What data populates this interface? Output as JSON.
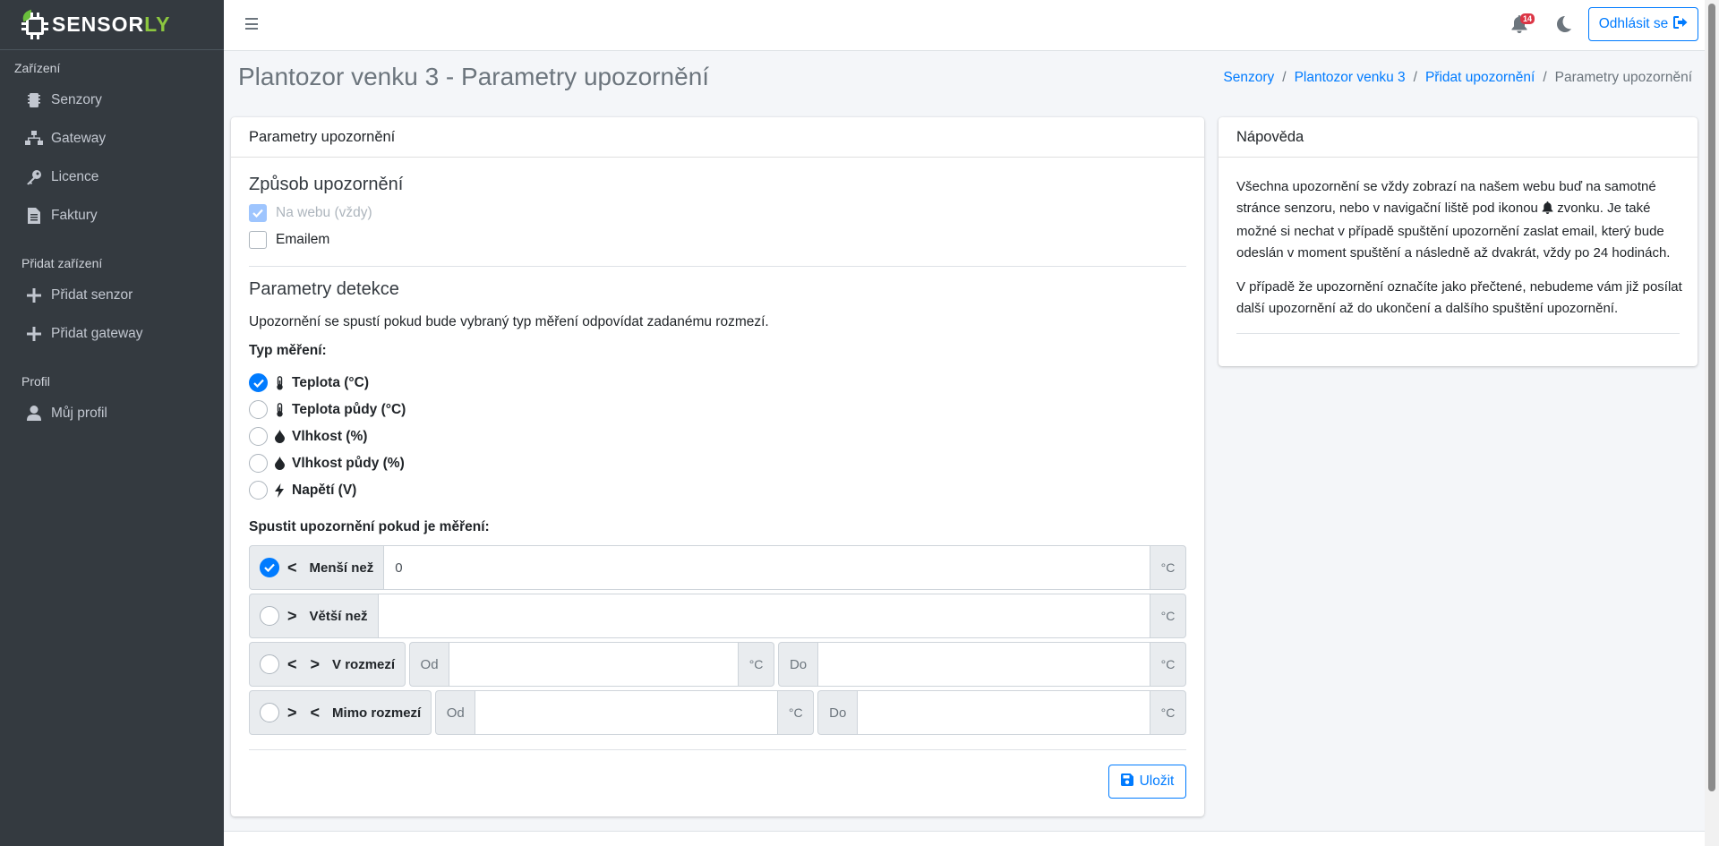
{
  "brand": {
    "name_main": "SENSOR",
    "name_accent": "LY",
    "accent_color": "#8cc63f"
  },
  "sidebar": {
    "section_devices": "Zařízení",
    "items_devices": [
      {
        "label": "Senzory",
        "icon": "microchip-icon"
      },
      {
        "label": "Gateway",
        "icon": "network-icon"
      },
      {
        "label": "Licence",
        "icon": "key-icon"
      },
      {
        "label": "Faktury",
        "icon": "invoice-icon"
      }
    ],
    "section_add": "Přidat zařízení",
    "items_add": [
      {
        "label": "Přidat senzor",
        "icon": "plus-icon"
      },
      {
        "label": "Přidat gateway",
        "icon": "plus-icon"
      }
    ],
    "section_profile": "Profil",
    "items_profile": [
      {
        "label": "Můj profil",
        "icon": "user-icon"
      }
    ]
  },
  "topbar": {
    "notifications_count": "14",
    "logout_label": "Odhlásit se"
  },
  "page": {
    "title": "Plantozor venku 3 - Parametry upozornění",
    "breadcrumb": [
      "Senzory",
      "Plantozor venku 3",
      "Přidat upozornění",
      "Parametry upozornění"
    ]
  },
  "form": {
    "card_title": "Parametry upozornění",
    "method_title": "Způsob upozornění",
    "method_web": "Na webu (vždy)",
    "method_email": "Emailem",
    "detection_title": "Parametry detekce",
    "detection_desc": "Upozornění se spustí pokud bude vybraný typ měření odpovídat zadanému rozmezí.",
    "type_label": "Typ měření:",
    "types": [
      {
        "label": "Teplota (°C)",
        "icon": "thermometer-icon",
        "selected": true
      },
      {
        "label": "Teplota půdy (°C)",
        "icon": "thermometer-icon",
        "selected": false
      },
      {
        "label": "Vlhkost (%)",
        "icon": "droplet-icon",
        "selected": false
      },
      {
        "label": "Vlhkost půdy (%)",
        "icon": "droplet-icon",
        "selected": false
      },
      {
        "label": "Napětí (V)",
        "icon": "bolt-icon",
        "selected": false
      }
    ],
    "trigger_label": "Spustit upozornění pokud je měření:",
    "conditions": {
      "less": {
        "symbol": "<",
        "label": "Menší než",
        "value": "0",
        "unit": "°C",
        "selected": true
      },
      "greater": {
        "symbol": ">",
        "label": "Větší než",
        "value": "",
        "unit": "°C",
        "selected": false
      },
      "range": {
        "symbol": "< >",
        "label": "V rozmezí",
        "from": "Od",
        "to": "Do",
        "unit": "°C",
        "selected": false
      },
      "outside": {
        "symbol": "> <",
        "label": "Mimo rozmezí",
        "from": "Od",
        "to": "Do",
        "unit": "°C",
        "selected": false
      }
    },
    "save_label": "Uložit"
  },
  "help": {
    "title": "Nápověda",
    "p1_a": "Všechna upozornění se vždy zobrazí na našem webu buď na samotné stránce senzoru, nebo v navigační liště pod ikonou",
    "p1_b": "zvonku. Je také možné si nechat v případě spuštění upozornění zaslat email, který bude odeslán v moment spuštění a následně až dvakrát, vždy po 24 hodinách.",
    "p2": "V případě že upozornění označíte jako přečtené, nebudeme vám již posílat další upozornění až do ukončení a dalšího spuštění upozornění."
  }
}
